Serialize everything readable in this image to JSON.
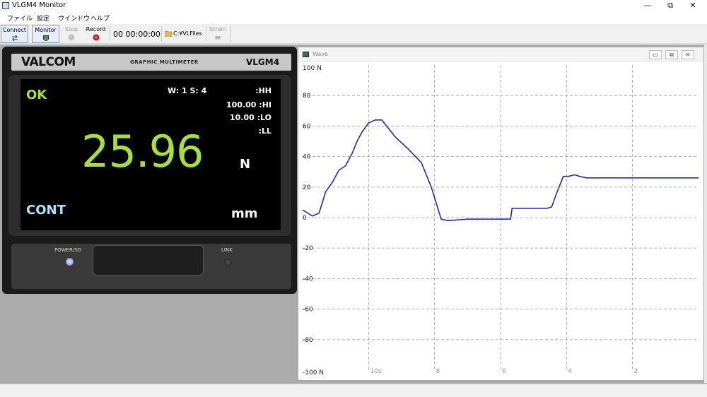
{
  "window": {
    "title": "VLGM4 Monitor",
    "controls": [
      "—",
      "⧉",
      "✕"
    ]
  },
  "menu": [
    "ファイル",
    "設定",
    "ウインドウ",
    "ヘルプ"
  ],
  "toolbar": {
    "connect": "Connect",
    "monitor": "Monitor",
    "stop": "Stop",
    "record": "Record",
    "elapsed": "00 00:00:00",
    "folder": "C:¥VLFiles",
    "strain": "Strain"
  },
  "meter": {
    "brand": "VALCOM",
    "description": "GRAPHIC MULTIMETER",
    "model": "VLGM4",
    "judge": "OK",
    "window_info": "W: 1 S: 4",
    "hh": ":HH",
    "hi": "100.00 :HI",
    "lo": "10.00 :LO",
    "ll": ":LL",
    "reading": "25.96",
    "unit": "N",
    "mode": "CONT",
    "mode_unit": "mm",
    "power_label": "POWER/SD",
    "link_label": "LINK"
  },
  "wave": {
    "title": "Wave",
    "controls": [
      "▭",
      "⧉",
      "✕"
    ]
  },
  "chart_data": {
    "type": "line",
    "ylim": [
      -100,
      100
    ],
    "y_ticks": [
      "100 N",
      "80",
      "60",
      "40",
      "20",
      "0",
      "-20",
      "-40",
      "-60",
      "-80",
      "-100 N"
    ],
    "x_ticks": [
      "10s",
      "8",
      "6",
      "4",
      "2"
    ],
    "x_range": [
      12,
      0
    ],
    "grid": true,
    "line_color": "#1a2dbd",
    "series": [
      {
        "x": [
          12.0,
          11.85,
          11.7,
          11.5,
          11.3,
          11.1,
          10.9,
          10.7,
          10.5,
          10.35,
          10.2,
          10.0,
          9.8,
          9.6,
          9.2,
          8.8,
          8.4,
          8.1,
          7.9,
          7.8,
          7.6,
          7.0,
          6.4,
          5.7,
          5.65,
          5.5,
          5.0,
          4.7,
          4.6,
          4.45,
          4.3,
          4.1,
          3.95,
          3.75,
          3.6,
          3.4,
          3.0,
          2.0,
          1.0,
          0.0
        ],
        "y": [
          5,
          3,
          1,
          3,
          17,
          23,
          31,
          34,
          42,
          50,
          56,
          62,
          64,
          64,
          53,
          45,
          36,
          20,
          6,
          -1,
          -2,
          -1,
          -1,
          -1,
          6,
          6,
          6,
          6,
          6,
          7,
          16,
          27,
          27,
          28,
          27,
          26,
          26,
          26,
          26,
          26
        ]
      }
    ]
  }
}
